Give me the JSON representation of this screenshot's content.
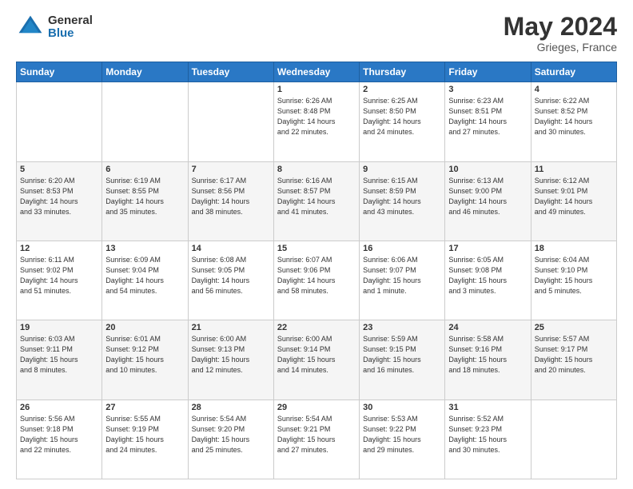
{
  "header": {
    "logo_general": "General",
    "logo_blue": "Blue",
    "title": "May 2024",
    "location": "Grieges, France"
  },
  "days_of_week": [
    "Sunday",
    "Monday",
    "Tuesday",
    "Wednesday",
    "Thursday",
    "Friday",
    "Saturday"
  ],
  "weeks": [
    [
      {
        "day": "",
        "info": ""
      },
      {
        "day": "",
        "info": ""
      },
      {
        "day": "",
        "info": ""
      },
      {
        "day": "1",
        "info": "Sunrise: 6:26 AM\nSunset: 8:48 PM\nDaylight: 14 hours\nand 22 minutes."
      },
      {
        "day": "2",
        "info": "Sunrise: 6:25 AM\nSunset: 8:50 PM\nDaylight: 14 hours\nand 24 minutes."
      },
      {
        "day": "3",
        "info": "Sunrise: 6:23 AM\nSunset: 8:51 PM\nDaylight: 14 hours\nand 27 minutes."
      },
      {
        "day": "4",
        "info": "Sunrise: 6:22 AM\nSunset: 8:52 PM\nDaylight: 14 hours\nand 30 minutes."
      }
    ],
    [
      {
        "day": "5",
        "info": "Sunrise: 6:20 AM\nSunset: 8:53 PM\nDaylight: 14 hours\nand 33 minutes."
      },
      {
        "day": "6",
        "info": "Sunrise: 6:19 AM\nSunset: 8:55 PM\nDaylight: 14 hours\nand 35 minutes."
      },
      {
        "day": "7",
        "info": "Sunrise: 6:17 AM\nSunset: 8:56 PM\nDaylight: 14 hours\nand 38 minutes."
      },
      {
        "day": "8",
        "info": "Sunrise: 6:16 AM\nSunset: 8:57 PM\nDaylight: 14 hours\nand 41 minutes."
      },
      {
        "day": "9",
        "info": "Sunrise: 6:15 AM\nSunset: 8:59 PM\nDaylight: 14 hours\nand 43 minutes."
      },
      {
        "day": "10",
        "info": "Sunrise: 6:13 AM\nSunset: 9:00 PM\nDaylight: 14 hours\nand 46 minutes."
      },
      {
        "day": "11",
        "info": "Sunrise: 6:12 AM\nSunset: 9:01 PM\nDaylight: 14 hours\nand 49 minutes."
      }
    ],
    [
      {
        "day": "12",
        "info": "Sunrise: 6:11 AM\nSunset: 9:02 PM\nDaylight: 14 hours\nand 51 minutes."
      },
      {
        "day": "13",
        "info": "Sunrise: 6:09 AM\nSunset: 9:04 PM\nDaylight: 14 hours\nand 54 minutes."
      },
      {
        "day": "14",
        "info": "Sunrise: 6:08 AM\nSunset: 9:05 PM\nDaylight: 14 hours\nand 56 minutes."
      },
      {
        "day": "15",
        "info": "Sunrise: 6:07 AM\nSunset: 9:06 PM\nDaylight: 14 hours\nand 58 minutes."
      },
      {
        "day": "16",
        "info": "Sunrise: 6:06 AM\nSunset: 9:07 PM\nDaylight: 15 hours\nand 1 minute."
      },
      {
        "day": "17",
        "info": "Sunrise: 6:05 AM\nSunset: 9:08 PM\nDaylight: 15 hours\nand 3 minutes."
      },
      {
        "day": "18",
        "info": "Sunrise: 6:04 AM\nSunset: 9:10 PM\nDaylight: 15 hours\nand 5 minutes."
      }
    ],
    [
      {
        "day": "19",
        "info": "Sunrise: 6:03 AM\nSunset: 9:11 PM\nDaylight: 15 hours\nand 8 minutes."
      },
      {
        "day": "20",
        "info": "Sunrise: 6:01 AM\nSunset: 9:12 PM\nDaylight: 15 hours\nand 10 minutes."
      },
      {
        "day": "21",
        "info": "Sunrise: 6:00 AM\nSunset: 9:13 PM\nDaylight: 15 hours\nand 12 minutes."
      },
      {
        "day": "22",
        "info": "Sunrise: 6:00 AM\nSunset: 9:14 PM\nDaylight: 15 hours\nand 14 minutes."
      },
      {
        "day": "23",
        "info": "Sunrise: 5:59 AM\nSunset: 9:15 PM\nDaylight: 15 hours\nand 16 minutes."
      },
      {
        "day": "24",
        "info": "Sunrise: 5:58 AM\nSunset: 9:16 PM\nDaylight: 15 hours\nand 18 minutes."
      },
      {
        "day": "25",
        "info": "Sunrise: 5:57 AM\nSunset: 9:17 PM\nDaylight: 15 hours\nand 20 minutes."
      }
    ],
    [
      {
        "day": "26",
        "info": "Sunrise: 5:56 AM\nSunset: 9:18 PM\nDaylight: 15 hours\nand 22 minutes."
      },
      {
        "day": "27",
        "info": "Sunrise: 5:55 AM\nSunset: 9:19 PM\nDaylight: 15 hours\nand 24 minutes."
      },
      {
        "day": "28",
        "info": "Sunrise: 5:54 AM\nSunset: 9:20 PM\nDaylight: 15 hours\nand 25 minutes."
      },
      {
        "day": "29",
        "info": "Sunrise: 5:54 AM\nSunset: 9:21 PM\nDaylight: 15 hours\nand 27 minutes."
      },
      {
        "day": "30",
        "info": "Sunrise: 5:53 AM\nSunset: 9:22 PM\nDaylight: 15 hours\nand 29 minutes."
      },
      {
        "day": "31",
        "info": "Sunrise: 5:52 AM\nSunset: 9:23 PM\nDaylight: 15 hours\nand 30 minutes."
      },
      {
        "day": "",
        "info": ""
      }
    ]
  ]
}
